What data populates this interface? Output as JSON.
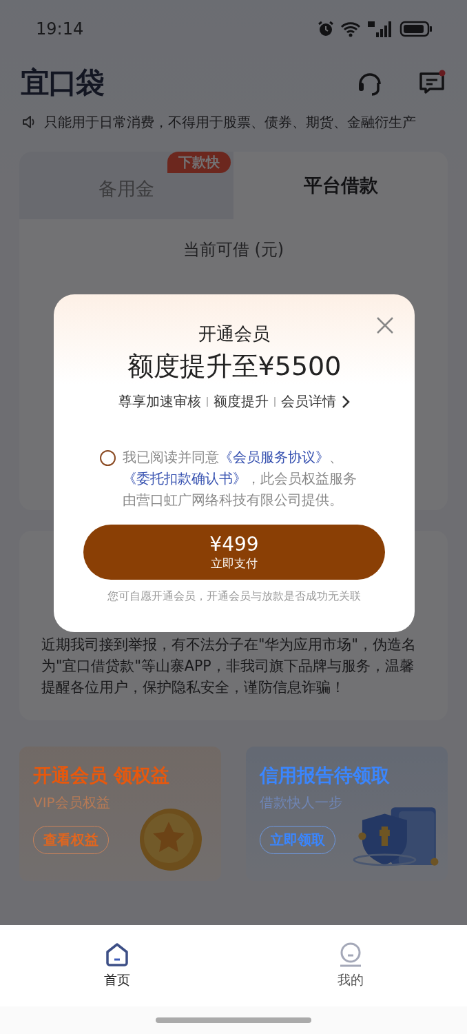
{
  "status_bar": {
    "time": "19:14"
  },
  "header": {
    "logo": "宜口袋",
    "message_unread": true
  },
  "notice": "只能用于日常消费，不得用于股票、债券、期货、金融衍生产",
  "tabs": [
    {
      "label": "备用金",
      "selected": false,
      "badge": "下款快"
    },
    {
      "label": "平台借款",
      "selected": true
    }
  ],
  "credit": {
    "label": "当前可借 (元)"
  },
  "warning": "近期我司接到举报，有不法分子在\"华为应用市场\"，伪造名为\"宜口借贷款\"等山寨APP，非我司旗下品牌与服务，温馨提醒各位用户，保护隐私安全，谨防信息诈骗！",
  "promos": [
    {
      "kind": "vip",
      "title": "开通会员 领权益",
      "subtitle": "VIP会员权益",
      "button": "查看权益"
    },
    {
      "kind": "credit",
      "title": "信用报告待领取",
      "subtitle": "借款快人一步",
      "button": "立即领取"
    }
  ],
  "modal": {
    "title": "开通会员",
    "headline": "额度提升至¥5500",
    "features": [
      "尊享加速审核",
      "额度提升",
      "会员详情"
    ],
    "agreement": {
      "checked": false,
      "prefix": "我已阅读并同意",
      "links": [
        "《会员服务协议》",
        "《委托扣款确认书》"
      ],
      "separator": "、",
      "suffix": "，此会员权益服务由营口虹广网络科技有限公司提供。"
    },
    "pay_button": {
      "price": "¥499",
      "label": "立即支付"
    },
    "footnote": "您可自愿开通会员，开通会员与放款是否成功无关联"
  },
  "bottom_nav": [
    {
      "label": "首页",
      "selected": true
    },
    {
      "label": "我的",
      "selected": false
    }
  ]
}
